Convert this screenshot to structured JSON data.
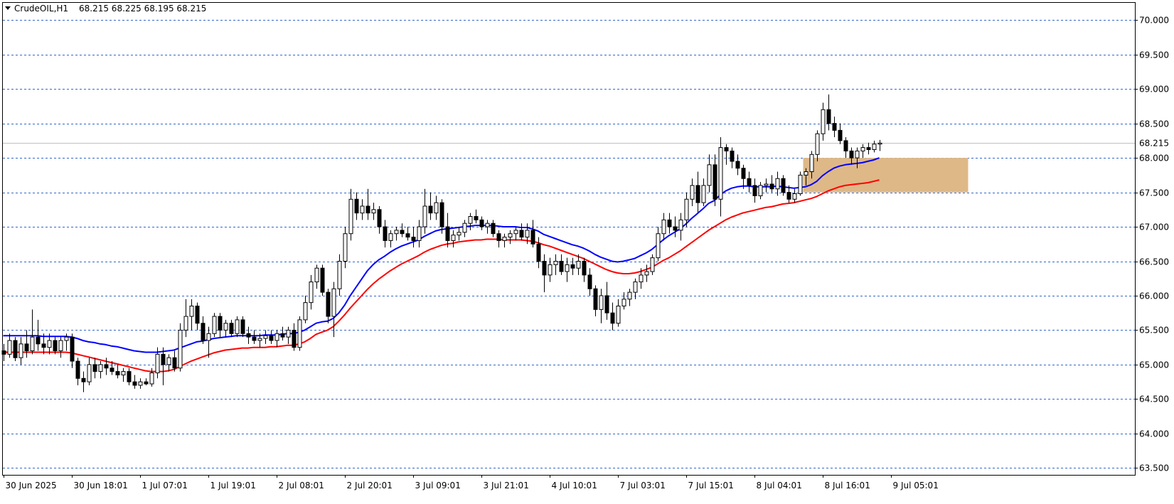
{
  "header": {
    "symbol_label": "CrudeOIL,H1",
    "ohlc": "68.215 68.225 68.195 68.215"
  },
  "colors": {
    "background": "#ffffff",
    "grid": "#3366cc",
    "frame": "#000000",
    "candle_bull_fill": "#ffffff",
    "candle_bear_fill": "#000000",
    "candle_stroke": "#000000",
    "ma_fast": "#0000ff",
    "ma_slow": "#ff0000",
    "zone_fill": "#deb887",
    "current_price_line": "#c0c0c0"
  },
  "chart_data": {
    "type": "candlestick",
    "symbol": "CrudeOIL",
    "timeframe": "H1",
    "ylim": [
      63.4,
      70.25
    ],
    "y_ticks": [
      "70.000",
      "69.500",
      "69.000",
      "68.500",
      "68.000",
      "67.500",
      "67.000",
      "66.500",
      "66.000",
      "65.500",
      "65.000",
      "64.500",
      "64.000",
      "63.500"
    ],
    "y_tick_values": [
      70.0,
      69.5,
      69.0,
      68.5,
      68.0,
      67.5,
      67.0,
      66.5,
      66.0,
      65.5,
      65.0,
      64.5,
      64.0,
      63.5
    ],
    "x_tick_labels": [
      "30 Jun 2025",
      "30 Jun 18:01",
      "1 Jul 07:01",
      "1 Jul 19:01",
      "2 Jul 08:01",
      "2 Jul 20:01",
      "3 Jul 09:01",
      "3 Jul 21:01",
      "4 Jul 10:01",
      "7 Jul 03:01",
      "7 Jul 15:01",
      "8 Jul 04:01",
      "8 Jul 16:01",
      "9 Jul 05:01"
    ],
    "x_tick_bar_index": [
      0,
      12,
      24,
      36,
      48,
      60,
      72,
      84,
      96,
      108,
      120,
      132,
      144,
      156
    ],
    "current_price": 68.215,
    "current_price_label": "68.215",
    "zone": {
      "from_bar": 141,
      "to_bar": 170,
      "low": 67.5,
      "high": 68.0
    },
    "candles": [
      [
        65.2,
        65.3,
        65.05,
        65.15
      ],
      [
        65.15,
        65.45,
        65.1,
        65.35
      ],
      [
        65.35,
        65.4,
        65.05,
        65.1
      ],
      [
        65.1,
        65.4,
        65.0,
        65.3
      ],
      [
        65.3,
        65.5,
        65.1,
        65.2
      ],
      [
        65.2,
        65.8,
        65.15,
        65.4
      ],
      [
        65.4,
        65.65,
        65.2,
        65.3
      ],
      [
        65.3,
        65.45,
        65.15,
        65.25
      ],
      [
        65.25,
        65.45,
        65.15,
        65.35
      ],
      [
        65.35,
        65.4,
        65.15,
        65.2
      ],
      [
        65.2,
        65.4,
        65.1,
        65.35
      ],
      [
        65.35,
        65.45,
        65.2,
        65.4
      ],
      [
        65.4,
        65.45,
        64.95,
        65.05
      ],
      [
        65.05,
        65.1,
        64.7,
        64.8
      ],
      [
        64.8,
        64.9,
        64.6,
        64.75
      ],
      [
        64.75,
        65.1,
        64.7,
        65.0
      ],
      [
        65.0,
        65.1,
        64.8,
        64.9
      ],
      [
        64.9,
        65.05,
        64.8,
        65.0
      ],
      [
        65.0,
        65.1,
        64.85,
        64.95
      ],
      [
        64.95,
        65.05,
        64.85,
        64.9
      ],
      [
        64.9,
        65.0,
        64.8,
        64.85
      ],
      [
        64.85,
        64.95,
        64.75,
        64.9
      ],
      [
        64.9,
        64.95,
        64.7,
        64.75
      ],
      [
        64.75,
        64.85,
        64.65,
        64.7
      ],
      [
        64.7,
        64.8,
        64.65,
        64.75
      ],
      [
        64.75,
        64.8,
        64.7,
        64.72
      ],
      [
        64.72,
        64.95,
        64.68,
        64.88
      ],
      [
        64.88,
        65.25,
        64.8,
        65.15
      ],
      [
        65.15,
        65.25,
        64.7,
        65.0
      ],
      [
        65.0,
        65.15,
        64.9,
        65.1
      ],
      [
        65.1,
        65.2,
        64.9,
        64.95
      ],
      [
        64.95,
        65.6,
        64.9,
        65.5
      ],
      [
        65.5,
        65.95,
        65.4,
        65.7
      ],
      [
        65.7,
        65.95,
        65.5,
        65.85
      ],
      [
        65.85,
        65.9,
        65.5,
        65.6
      ],
      [
        65.6,
        65.7,
        65.3,
        65.35
      ],
      [
        65.35,
        65.55,
        65.1,
        65.45
      ],
      [
        65.45,
        65.75,
        65.4,
        65.7
      ],
      [
        65.7,
        65.75,
        65.4,
        65.5
      ],
      [
        65.5,
        65.65,
        65.4,
        65.6
      ],
      [
        65.6,
        65.65,
        65.4,
        65.45
      ],
      [
        65.45,
        65.7,
        65.4,
        65.65
      ],
      [
        65.65,
        65.7,
        65.4,
        65.45
      ],
      [
        65.45,
        65.55,
        65.3,
        65.4
      ],
      [
        65.4,
        65.5,
        65.3,
        65.35
      ],
      [
        65.35,
        65.45,
        65.25,
        65.38
      ],
      [
        65.38,
        65.5,
        65.3,
        65.42
      ],
      [
        65.42,
        65.5,
        65.3,
        65.35
      ],
      [
        65.35,
        65.5,
        65.25,
        65.45
      ],
      [
        65.45,
        65.55,
        65.35,
        65.4
      ],
      [
        65.4,
        65.55,
        65.3,
        65.5
      ],
      [
        65.5,
        65.6,
        65.2,
        65.25
      ],
      [
        65.25,
        65.7,
        65.2,
        65.65
      ],
      [
        65.65,
        66.0,
        65.6,
        65.9
      ],
      [
        65.9,
        66.3,
        65.8,
        66.2
      ],
      [
        66.2,
        66.45,
        66.1,
        66.4
      ],
      [
        66.4,
        66.45,
        66.0,
        66.05
      ],
      [
        66.05,
        66.1,
        65.6,
        65.7
      ],
      [
        65.7,
        66.2,
        65.4,
        66.1
      ],
      [
        66.1,
        66.6,
        66.0,
        66.5
      ],
      [
        66.5,
        67.0,
        66.4,
        66.9
      ],
      [
        66.9,
        67.55,
        66.8,
        67.4
      ],
      [
        67.4,
        67.5,
        67.1,
        67.2
      ],
      [
        67.2,
        67.4,
        67.1,
        67.3
      ],
      [
        67.3,
        67.55,
        67.1,
        67.2
      ],
      [
        67.2,
        67.35,
        67.1,
        67.25
      ],
      [
        67.25,
        67.3,
        66.9,
        67.0
      ],
      [
        67.0,
        67.1,
        66.7,
        66.8
      ],
      [
        66.8,
        66.95,
        66.7,
        66.9
      ],
      [
        66.9,
        67.0,
        66.8,
        66.95
      ],
      [
        66.95,
        67.05,
        66.85,
        66.9
      ],
      [
        66.9,
        67.0,
        66.8,
        66.85
      ],
      [
        66.85,
        67.0,
        66.7,
        66.8
      ],
      [
        66.8,
        67.1,
        66.7,
        67.0
      ],
      [
        67.0,
        67.55,
        66.9,
        67.3
      ],
      [
        67.3,
        67.5,
        67.1,
        67.2
      ],
      [
        67.2,
        67.45,
        67.1,
        67.35
      ],
      [
        67.35,
        67.4,
        66.9,
        67.0
      ],
      [
        67.0,
        67.2,
        66.7,
        66.8
      ],
      [
        66.8,
        66.95,
        66.7,
        66.88
      ],
      [
        66.88,
        67.0,
        66.8,
        66.92
      ],
      [
        66.92,
        67.1,
        66.85,
        67.05
      ],
      [
        67.05,
        67.2,
        66.95,
        67.15
      ],
      [
        67.15,
        67.25,
        67.05,
        67.1
      ],
      [
        67.1,
        67.15,
        66.95,
        67.0
      ],
      [
        67.0,
        67.1,
        66.9,
        67.05
      ],
      [
        67.05,
        67.1,
        66.85,
        66.9
      ],
      [
        66.9,
        66.95,
        66.7,
        66.8
      ],
      [
        66.8,
        66.9,
        66.7,
        66.85
      ],
      [
        66.85,
        66.95,
        66.75,
        66.9
      ],
      [
        66.9,
        67.0,
        66.8,
        66.95
      ],
      [
        66.95,
        67.05,
        66.8,
        66.85
      ],
      [
        66.85,
        67.05,
        66.75,
        66.95
      ],
      [
        66.95,
        67.1,
        66.7,
        66.75
      ],
      [
        66.75,
        66.85,
        66.4,
        66.5
      ],
      [
        66.5,
        66.6,
        66.05,
        66.3
      ],
      [
        66.3,
        66.55,
        66.2,
        66.45
      ],
      [
        66.45,
        66.6,
        66.3,
        66.5
      ],
      [
        66.5,
        66.6,
        66.3,
        66.35
      ],
      [
        66.35,
        66.55,
        66.2,
        66.45
      ],
      [
        66.45,
        66.55,
        66.3,
        66.4
      ],
      [
        66.4,
        66.6,
        66.3,
        66.5
      ],
      [
        66.5,
        66.55,
        66.2,
        66.3
      ],
      [
        66.3,
        66.4,
        66.0,
        66.1
      ],
      [
        66.1,
        66.15,
        65.7,
        65.8
      ],
      [
        65.8,
        66.1,
        65.6,
        66.0
      ],
      [
        66.0,
        66.2,
        65.65,
        65.75
      ],
      [
        65.75,
        65.9,
        65.5,
        65.6
      ],
      [
        65.6,
        65.95,
        65.55,
        65.85
      ],
      [
        65.85,
        66.05,
        65.8,
        65.95
      ],
      [
        65.95,
        66.1,
        65.85,
        66.05
      ],
      [
        66.05,
        66.25,
        65.95,
        66.2
      ],
      [
        66.2,
        66.4,
        66.1,
        66.3
      ],
      [
        66.3,
        66.45,
        66.2,
        66.35
      ],
      [
        66.35,
        66.6,
        66.3,
        66.55
      ],
      [
        66.55,
        67.0,
        66.5,
        66.9
      ],
      [
        66.9,
        67.2,
        66.8,
        67.1
      ],
      [
        67.1,
        67.2,
        66.9,
        67.0
      ],
      [
        67.0,
        67.15,
        66.85,
        66.95
      ],
      [
        66.95,
        67.2,
        66.8,
        67.1
      ],
      [
        67.1,
        67.5,
        67.0,
        67.4
      ],
      [
        67.4,
        67.7,
        67.3,
        67.6
      ],
      [
        67.6,
        67.8,
        67.2,
        67.35
      ],
      [
        67.35,
        67.7,
        67.3,
        67.6
      ],
      [
        67.6,
        68.05,
        67.5,
        67.9
      ],
      [
        67.9,
        68.05,
        67.3,
        67.4
      ],
      [
        67.4,
        68.3,
        67.15,
        68.15
      ],
      [
        68.15,
        68.2,
        67.9,
        68.1
      ],
      [
        68.1,
        68.15,
        67.85,
        67.95
      ],
      [
        67.95,
        68.05,
        67.75,
        67.85
      ],
      [
        67.85,
        67.9,
        67.55,
        67.7
      ],
      [
        67.7,
        67.8,
        67.5,
        67.6
      ],
      [
        67.6,
        67.7,
        67.35,
        67.45
      ],
      [
        67.45,
        67.65,
        67.4,
        67.6
      ],
      [
        67.6,
        67.7,
        67.5,
        67.62
      ],
      [
        67.62,
        67.75,
        67.5,
        67.55
      ],
      [
        67.55,
        67.8,
        67.45,
        67.7
      ],
      [
        67.7,
        67.75,
        67.45,
        67.5
      ],
      [
        67.5,
        67.6,
        67.35,
        67.4
      ],
      [
        67.4,
        67.55,
        67.35,
        67.48
      ],
      [
        67.48,
        67.8,
        67.45,
        67.75
      ],
      [
        67.75,
        67.85,
        67.6,
        67.8
      ],
      [
        67.8,
        68.1,
        67.7,
        68.05
      ],
      [
        68.05,
        68.4,
        67.95,
        68.35
      ],
      [
        68.35,
        68.8,
        68.25,
        68.7
      ],
      [
        68.7,
        68.92,
        68.4,
        68.5
      ],
      [
        68.5,
        68.6,
        68.3,
        68.4
      ],
      [
        68.4,
        68.5,
        68.2,
        68.25
      ],
      [
        68.25,
        68.3,
        68.0,
        68.1
      ],
      [
        68.1,
        68.15,
        67.9,
        68.0
      ],
      [
        68.0,
        68.15,
        67.85,
        68.1
      ],
      [
        68.1,
        68.2,
        68.0,
        68.15
      ],
      [
        68.15,
        68.22,
        68.05,
        68.12
      ],
      [
        68.12,
        68.25,
        68.08,
        68.2
      ],
      [
        68.2,
        68.26,
        68.1,
        68.215
      ]
    ],
    "series": [
      {
        "color": "#0000ff",
        "values": [
          65.42,
          65.42,
          65.42,
          65.42,
          65.42,
          65.42,
          65.42,
          65.41,
          65.41,
          65.41,
          65.41,
          65.41,
          65.4,
          65.38,
          65.35,
          65.33,
          65.32,
          65.3,
          65.29,
          65.27,
          65.26,
          65.24,
          65.22,
          65.2,
          65.19,
          65.18,
          65.18,
          65.18,
          65.19,
          65.2,
          65.21,
          65.24,
          65.27,
          65.3,
          65.33,
          65.34,
          65.36,
          65.38,
          65.39,
          65.4,
          65.41,
          65.42,
          65.42,
          65.42,
          65.42,
          65.42,
          65.43,
          65.43,
          65.43,
          65.44,
          65.45,
          65.45,
          65.47,
          65.5,
          65.55,
          65.6,
          65.62,
          65.63,
          65.67,
          65.75,
          65.86,
          66.0,
          66.12,
          66.24,
          66.36,
          66.45,
          66.52,
          66.57,
          66.63,
          66.68,
          66.72,
          66.75,
          66.78,
          66.81,
          66.86,
          66.9,
          66.94,
          66.96,
          66.97,
          66.98,
          66.99,
          67.0,
          67.01,
          67.02,
          67.02,
          67.02,
          67.02,
          67.01,
          67.0,
          67.0,
          67.0,
          66.99,
          66.99,
          66.97,
          66.94,
          66.89,
          66.86,
          66.83,
          66.8,
          66.77,
          66.74,
          66.72,
          66.69,
          66.65,
          66.6,
          66.56,
          66.53,
          66.5,
          66.49,
          66.5,
          66.52,
          66.54,
          66.58,
          66.62,
          66.67,
          66.74,
          66.81,
          66.87,
          66.92,
          66.97,
          67.04,
          67.12,
          67.19,
          67.26,
          67.34,
          67.38,
          67.46,
          67.52,
          67.56,
          67.58,
          67.59,
          67.59,
          67.58,
          67.58,
          67.58,
          67.58,
          67.59,
          67.58,
          67.57,
          67.56,
          67.57,
          67.58,
          67.61,
          67.66,
          67.74,
          67.8,
          67.85,
          67.88,
          67.9,
          67.91,
          67.92,
          67.93,
          67.95,
          67.97,
          68.0
        ]
      },
      {
        "color": "#ff0000",
        "values": [
          65.18,
          65.18,
          65.18,
          65.18,
          65.18,
          65.18,
          65.18,
          65.18,
          65.18,
          65.18,
          65.18,
          65.18,
          65.17,
          65.15,
          65.13,
          65.11,
          65.09,
          65.07,
          65.05,
          65.03,
          65.01,
          64.99,
          64.97,
          64.95,
          64.93,
          64.91,
          64.9,
          64.9,
          64.9,
          64.91,
          64.93,
          64.97,
          65.01,
          65.05,
          65.08,
          65.11,
          65.14,
          65.17,
          65.19,
          65.21,
          65.22,
          65.23,
          65.24,
          65.24,
          65.25,
          65.25,
          65.25,
          65.26,
          65.26,
          65.27,
          65.28,
          65.28,
          65.3,
          65.33,
          65.38,
          65.44,
          65.47,
          65.5,
          65.55,
          65.63,
          65.72,
          65.82,
          65.91,
          66.0,
          66.09,
          66.17,
          66.24,
          66.3,
          66.36,
          66.41,
          66.46,
          66.5,
          66.54,
          66.58,
          66.63,
          66.67,
          66.7,
          66.73,
          66.75,
          66.76,
          66.78,
          66.79,
          66.8,
          66.81,
          66.81,
          66.82,
          66.82,
          66.82,
          66.81,
          66.81,
          66.81,
          66.81,
          66.8,
          66.79,
          66.77,
          66.74,
          66.72,
          66.69,
          66.66,
          66.63,
          66.6,
          66.57,
          66.54,
          66.5,
          66.46,
          66.42,
          66.38,
          66.35,
          66.33,
          66.32,
          66.32,
          66.33,
          66.35,
          66.38,
          66.41,
          66.46,
          66.51,
          66.55,
          66.6,
          66.65,
          66.71,
          66.77,
          66.83,
          66.89,
          66.95,
          67.0,
          67.05,
          67.1,
          67.14,
          67.17,
          67.2,
          67.22,
          67.24,
          67.26,
          67.28,
          67.29,
          67.31,
          67.33,
          67.34,
          67.35,
          67.37,
          67.39,
          67.41,
          67.44,
          67.48,
          67.52,
          67.55,
          67.58,
          67.6,
          67.61,
          67.62,
          67.63,
          67.64,
          67.66,
          67.68
        ]
      }
    ]
  }
}
